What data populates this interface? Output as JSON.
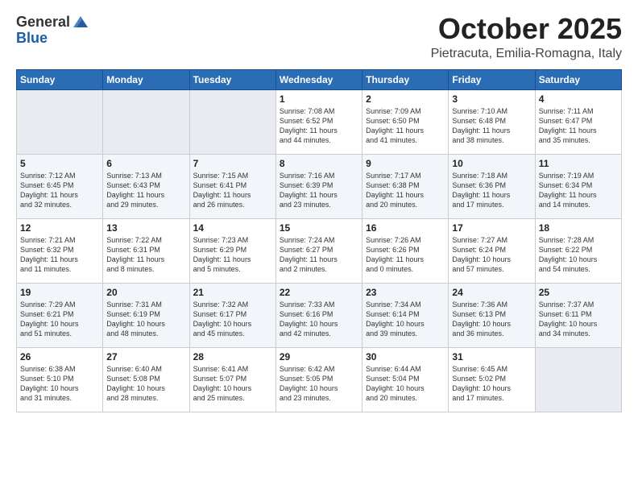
{
  "header": {
    "logo_general": "General",
    "logo_blue": "Blue",
    "month": "October 2025",
    "location": "Pietracuta, Emilia-Romagna, Italy"
  },
  "weekdays": [
    "Sunday",
    "Monday",
    "Tuesday",
    "Wednesday",
    "Thursday",
    "Friday",
    "Saturday"
  ],
  "weeks": [
    [
      {
        "day": "",
        "info": ""
      },
      {
        "day": "",
        "info": ""
      },
      {
        "day": "",
        "info": ""
      },
      {
        "day": "1",
        "info": "Sunrise: 7:08 AM\nSunset: 6:52 PM\nDaylight: 11 hours\nand 44 minutes."
      },
      {
        "day": "2",
        "info": "Sunrise: 7:09 AM\nSunset: 6:50 PM\nDaylight: 11 hours\nand 41 minutes."
      },
      {
        "day": "3",
        "info": "Sunrise: 7:10 AM\nSunset: 6:48 PM\nDaylight: 11 hours\nand 38 minutes."
      },
      {
        "day": "4",
        "info": "Sunrise: 7:11 AM\nSunset: 6:47 PM\nDaylight: 11 hours\nand 35 minutes."
      }
    ],
    [
      {
        "day": "5",
        "info": "Sunrise: 7:12 AM\nSunset: 6:45 PM\nDaylight: 11 hours\nand 32 minutes."
      },
      {
        "day": "6",
        "info": "Sunrise: 7:13 AM\nSunset: 6:43 PM\nDaylight: 11 hours\nand 29 minutes."
      },
      {
        "day": "7",
        "info": "Sunrise: 7:15 AM\nSunset: 6:41 PM\nDaylight: 11 hours\nand 26 minutes."
      },
      {
        "day": "8",
        "info": "Sunrise: 7:16 AM\nSunset: 6:39 PM\nDaylight: 11 hours\nand 23 minutes."
      },
      {
        "day": "9",
        "info": "Sunrise: 7:17 AM\nSunset: 6:38 PM\nDaylight: 11 hours\nand 20 minutes."
      },
      {
        "day": "10",
        "info": "Sunrise: 7:18 AM\nSunset: 6:36 PM\nDaylight: 11 hours\nand 17 minutes."
      },
      {
        "day": "11",
        "info": "Sunrise: 7:19 AM\nSunset: 6:34 PM\nDaylight: 11 hours\nand 14 minutes."
      }
    ],
    [
      {
        "day": "12",
        "info": "Sunrise: 7:21 AM\nSunset: 6:32 PM\nDaylight: 11 hours\nand 11 minutes."
      },
      {
        "day": "13",
        "info": "Sunrise: 7:22 AM\nSunset: 6:31 PM\nDaylight: 11 hours\nand 8 minutes."
      },
      {
        "day": "14",
        "info": "Sunrise: 7:23 AM\nSunset: 6:29 PM\nDaylight: 11 hours\nand 5 minutes."
      },
      {
        "day": "15",
        "info": "Sunrise: 7:24 AM\nSunset: 6:27 PM\nDaylight: 11 hours\nand 2 minutes."
      },
      {
        "day": "16",
        "info": "Sunrise: 7:26 AM\nSunset: 6:26 PM\nDaylight: 11 hours\nand 0 minutes."
      },
      {
        "day": "17",
        "info": "Sunrise: 7:27 AM\nSunset: 6:24 PM\nDaylight: 10 hours\nand 57 minutes."
      },
      {
        "day": "18",
        "info": "Sunrise: 7:28 AM\nSunset: 6:22 PM\nDaylight: 10 hours\nand 54 minutes."
      }
    ],
    [
      {
        "day": "19",
        "info": "Sunrise: 7:29 AM\nSunset: 6:21 PM\nDaylight: 10 hours\nand 51 minutes."
      },
      {
        "day": "20",
        "info": "Sunrise: 7:31 AM\nSunset: 6:19 PM\nDaylight: 10 hours\nand 48 minutes."
      },
      {
        "day": "21",
        "info": "Sunrise: 7:32 AM\nSunset: 6:17 PM\nDaylight: 10 hours\nand 45 minutes."
      },
      {
        "day": "22",
        "info": "Sunrise: 7:33 AM\nSunset: 6:16 PM\nDaylight: 10 hours\nand 42 minutes."
      },
      {
        "day": "23",
        "info": "Sunrise: 7:34 AM\nSunset: 6:14 PM\nDaylight: 10 hours\nand 39 minutes."
      },
      {
        "day": "24",
        "info": "Sunrise: 7:36 AM\nSunset: 6:13 PM\nDaylight: 10 hours\nand 36 minutes."
      },
      {
        "day": "25",
        "info": "Sunrise: 7:37 AM\nSunset: 6:11 PM\nDaylight: 10 hours\nand 34 minutes."
      }
    ],
    [
      {
        "day": "26",
        "info": "Sunrise: 6:38 AM\nSunset: 5:10 PM\nDaylight: 10 hours\nand 31 minutes."
      },
      {
        "day": "27",
        "info": "Sunrise: 6:40 AM\nSunset: 5:08 PM\nDaylight: 10 hours\nand 28 minutes."
      },
      {
        "day": "28",
        "info": "Sunrise: 6:41 AM\nSunset: 5:07 PM\nDaylight: 10 hours\nand 25 minutes."
      },
      {
        "day": "29",
        "info": "Sunrise: 6:42 AM\nSunset: 5:05 PM\nDaylight: 10 hours\nand 23 minutes."
      },
      {
        "day": "30",
        "info": "Sunrise: 6:44 AM\nSunset: 5:04 PM\nDaylight: 10 hours\nand 20 minutes."
      },
      {
        "day": "31",
        "info": "Sunrise: 6:45 AM\nSunset: 5:02 PM\nDaylight: 10 hours\nand 17 minutes."
      },
      {
        "day": "",
        "info": ""
      }
    ]
  ]
}
